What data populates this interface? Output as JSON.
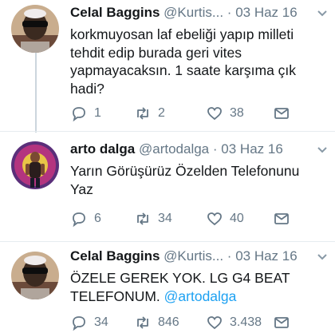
{
  "tweets": [
    {
      "name": "Celal Baggins",
      "handle": "@Kurtis...",
      "dot": "·",
      "date": "03 Haz 16",
      "lines": [
        "korkmuyosan laf ebeliği yapıp milleti",
        "tehdit edip burada geri vites",
        "yapmayacaksın. 1 saate karşıma çık",
        "hadi?"
      ],
      "replies": "1",
      "retweets": "2",
      "likes": "38"
    },
    {
      "name": "arto dalga",
      "handle": "@artodalga",
      "dot": "·",
      "date": "03 Haz 16",
      "lines": [
        "Yarın Görüşürüz Özelden Telefonunu",
        "Yaz"
      ],
      "replies": "6",
      "retweets": "34",
      "likes": "40"
    },
    {
      "name": "Celal Baggins",
      "handle": "@Kurtis...",
      "dot": "·",
      "date": "03 Haz 16",
      "line1": "ÖZELE GEREK YOK. LG G4 BEAT",
      "line2_text": "TELEFONUM. ",
      "line2_mention": "@artodalga",
      "replies": "34",
      "retweets": "846",
      "likes": "3.438"
    }
  ],
  "icons": {
    "reply": "reply-icon",
    "retweet": "retweet-icon",
    "like": "heart-icon",
    "message": "envelope-icon",
    "caret": "chevron-down-icon"
  },
  "colors": {
    "text": "#14171a",
    "secondary": "#657786",
    "mention": "#1da1f2",
    "divider": "#e6ecf0"
  }
}
